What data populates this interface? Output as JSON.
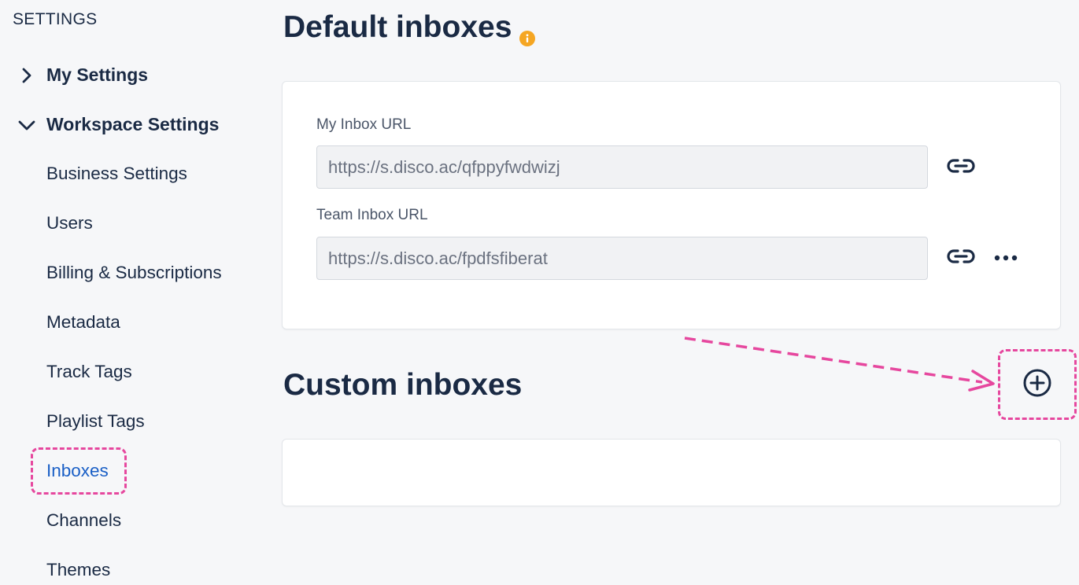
{
  "sidebar": {
    "heading": "SETTINGS",
    "sections": [
      {
        "label": "My Settings",
        "expanded": false
      },
      {
        "label": "Workspace Settings",
        "expanded": true
      }
    ],
    "items": [
      {
        "label": "Business Settings"
      },
      {
        "label": "Users"
      },
      {
        "label": "Billing & Subscriptions"
      },
      {
        "label": "Metadata"
      },
      {
        "label": "Track Tags"
      },
      {
        "label": "Playlist Tags"
      },
      {
        "label": "Inboxes",
        "active": true
      },
      {
        "label": "Channels"
      },
      {
        "label": "Themes"
      }
    ]
  },
  "default_inboxes": {
    "title": "Default inboxes",
    "my_inbox": {
      "label": "My Inbox URL",
      "value": "https://s.disco.ac/qfppyfwdwizj"
    },
    "team_inbox": {
      "label": "Team Inbox URL",
      "value": "https://s.disco.ac/fpdfsfiberat"
    }
  },
  "custom_inboxes": {
    "title": "Custom inboxes"
  },
  "colors": {
    "accent": "#1a5fc6",
    "text": "#1a2a44",
    "info": "#f5a623",
    "annotation": "#e6479e",
    "background": "#f6f7f9"
  },
  "icons": {
    "section_collapsed": "chevron-right-icon",
    "section_expanded": "chevron-down-icon",
    "info": "info-icon",
    "copy_link": "link-icon",
    "more": "more-horizontal-icon",
    "add": "plus-circle-icon"
  }
}
